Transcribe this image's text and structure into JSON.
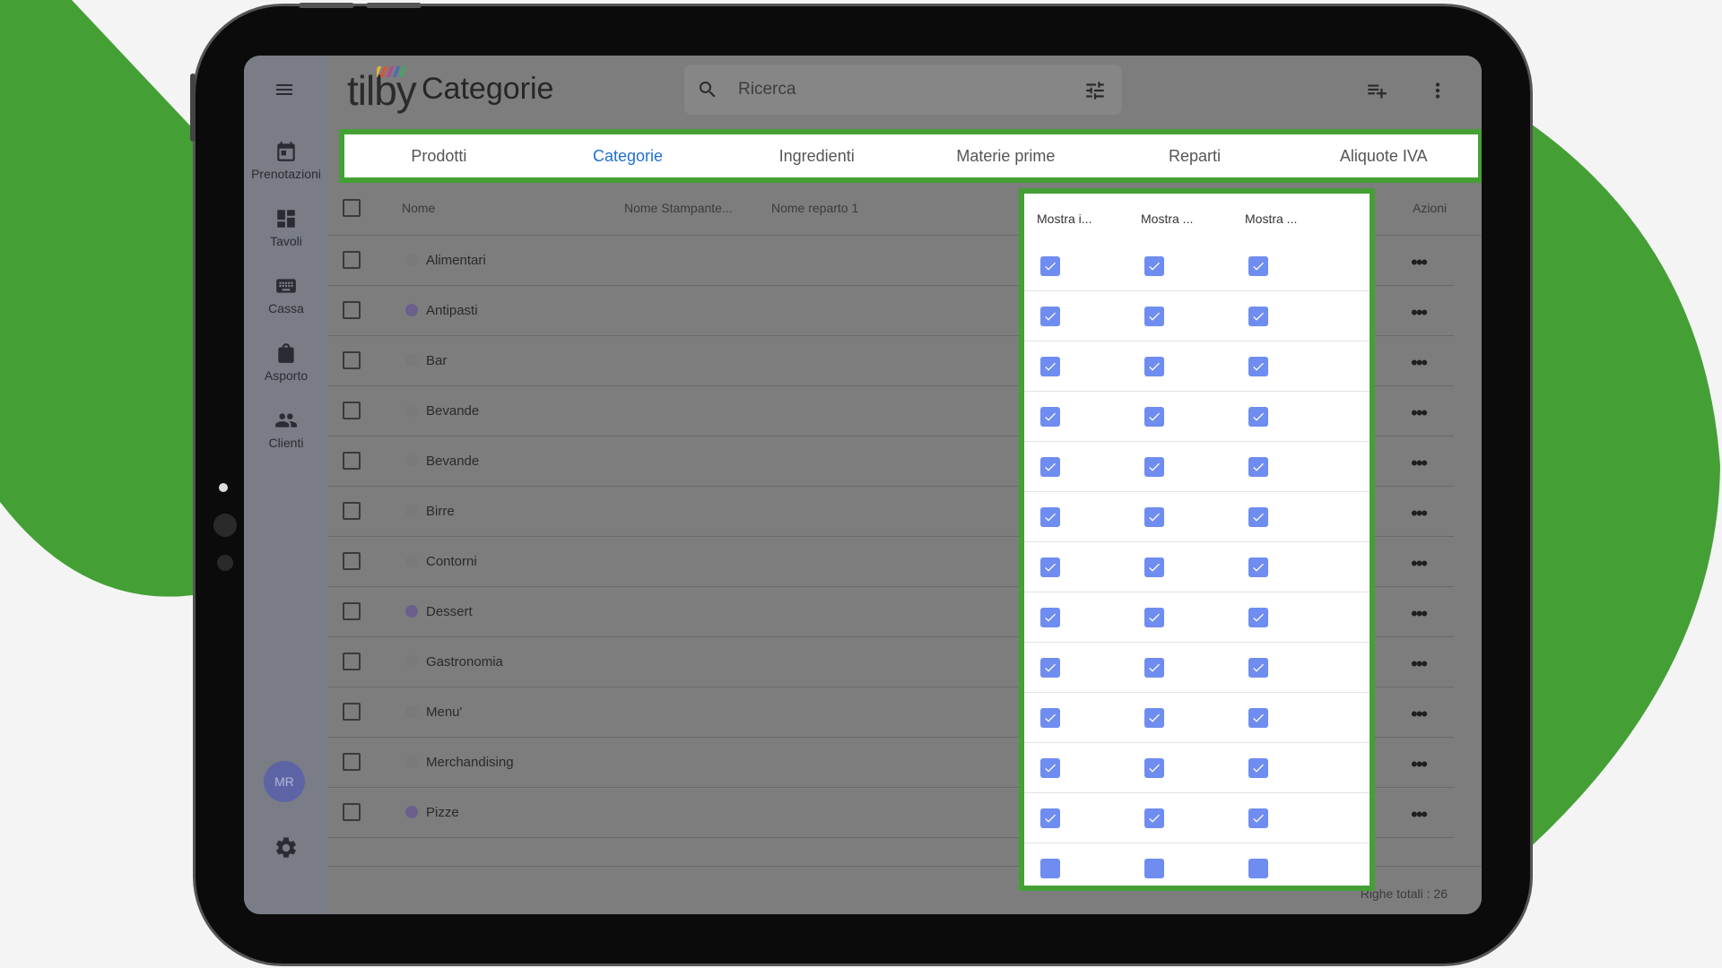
{
  "app": {
    "logo_text": "tilby",
    "page_title": "Categorie",
    "search_placeholder": "Ricerca"
  },
  "sidebar": {
    "items": [
      {
        "label": "Prenotazioni",
        "icon": "calendar-icon"
      },
      {
        "label": "Tavoli",
        "icon": "tables-icon"
      },
      {
        "label": "Cassa",
        "icon": "keyboard-icon"
      },
      {
        "label": "Asporto",
        "icon": "shopping-bag-icon"
      },
      {
        "label": "Clienti",
        "icon": "people-icon"
      }
    ],
    "avatar_initials": "MR"
  },
  "tabs": [
    {
      "label": "Prodotti",
      "active": false
    },
    {
      "label": "Categorie",
      "active": true
    },
    {
      "label": "Ingredienti",
      "active": false
    },
    {
      "label": "Materie prime",
      "active": false
    },
    {
      "label": "Reparti",
      "active": false
    },
    {
      "label": "Aliquote IVA",
      "active": false
    }
  ],
  "table": {
    "columns": {
      "nome": "Nome",
      "stampante": "Nome Stampante...",
      "reparto": "Nome reparto 1",
      "mostra1": "Mostra i...",
      "mostra2": "Mostra ...",
      "mostra3": "Mostra ...",
      "azioni": "Azioni"
    },
    "rows": [
      {
        "name": "Alimentari",
        "color": "none",
        "checks": [
          true,
          true,
          true
        ]
      },
      {
        "name": "Antipasti",
        "color": "purple",
        "checks": [
          true,
          true,
          true
        ]
      },
      {
        "name": "Bar",
        "color": "none",
        "checks": [
          true,
          true,
          true
        ]
      },
      {
        "name": "Bevande",
        "color": "none",
        "checks": [
          true,
          true,
          true
        ]
      },
      {
        "name": "Bevande",
        "color": "none",
        "checks": [
          true,
          true,
          true
        ]
      },
      {
        "name": "Birre",
        "color": "none",
        "checks": [
          true,
          true,
          true
        ]
      },
      {
        "name": "Contorni",
        "color": "none",
        "checks": [
          true,
          true,
          true
        ]
      },
      {
        "name": "Dessert",
        "color": "purple",
        "checks": [
          true,
          true,
          true
        ]
      },
      {
        "name": "Gastronomia",
        "color": "none",
        "checks": [
          true,
          true,
          true
        ]
      },
      {
        "name": "Menu'",
        "color": "none",
        "checks": [
          true,
          true,
          true
        ]
      },
      {
        "name": "Merchandising",
        "color": "none",
        "checks": [
          true,
          true,
          true
        ]
      },
      {
        "name": "Pizze",
        "color": "purple",
        "checks": [
          true,
          true,
          true
        ]
      }
    ],
    "row_action_glyph": "•••",
    "footer_total": "Righe totali : 26"
  },
  "colors": {
    "highlight_green": "#44a035",
    "active_tab_blue": "#1f6fd0",
    "checkbox_blue": "#6f8df0",
    "category_purple": "#6b5f8d"
  }
}
